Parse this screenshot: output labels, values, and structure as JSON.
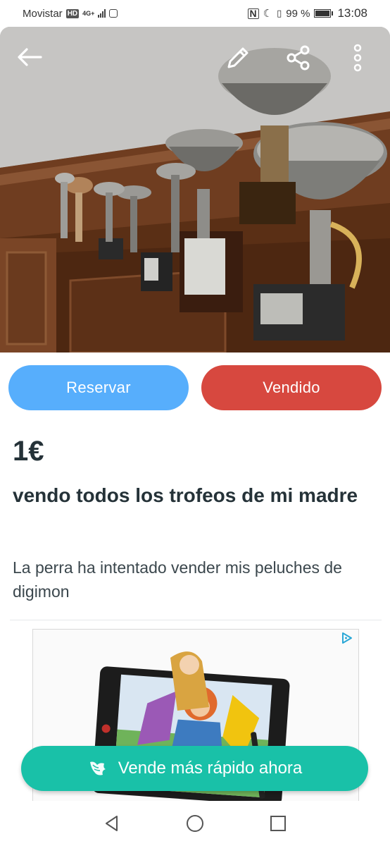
{
  "status_bar": {
    "carrier": "Movistar",
    "hd": "HD",
    "network": "4G+",
    "battery": "99 %",
    "time": "13:08"
  },
  "header": {
    "back_icon": "arrow-left-icon",
    "edit_icon": "pencil-icon",
    "share_icon": "share-icon",
    "more_icon": "more-vertical-icon"
  },
  "actions": {
    "reserve_label": "Reservar",
    "sold_label": "Vendido",
    "reserve_color": "#57aefc",
    "sold_color": "#d7483f"
  },
  "listing": {
    "price": "1€",
    "title": "vendo todos los trofeos de mi madre",
    "description": "La perra ha intentado vender mis peluches de digimon"
  },
  "ad": {
    "badge_icon": "adchoices-icon"
  },
  "cta": {
    "label": "Vende más rápido ahora",
    "icon": "wing-icon",
    "color": "#19c1a8"
  },
  "nav": {
    "back_icon": "nav-back-icon",
    "home_icon": "nav-home-icon",
    "recents_icon": "nav-recents-icon"
  }
}
